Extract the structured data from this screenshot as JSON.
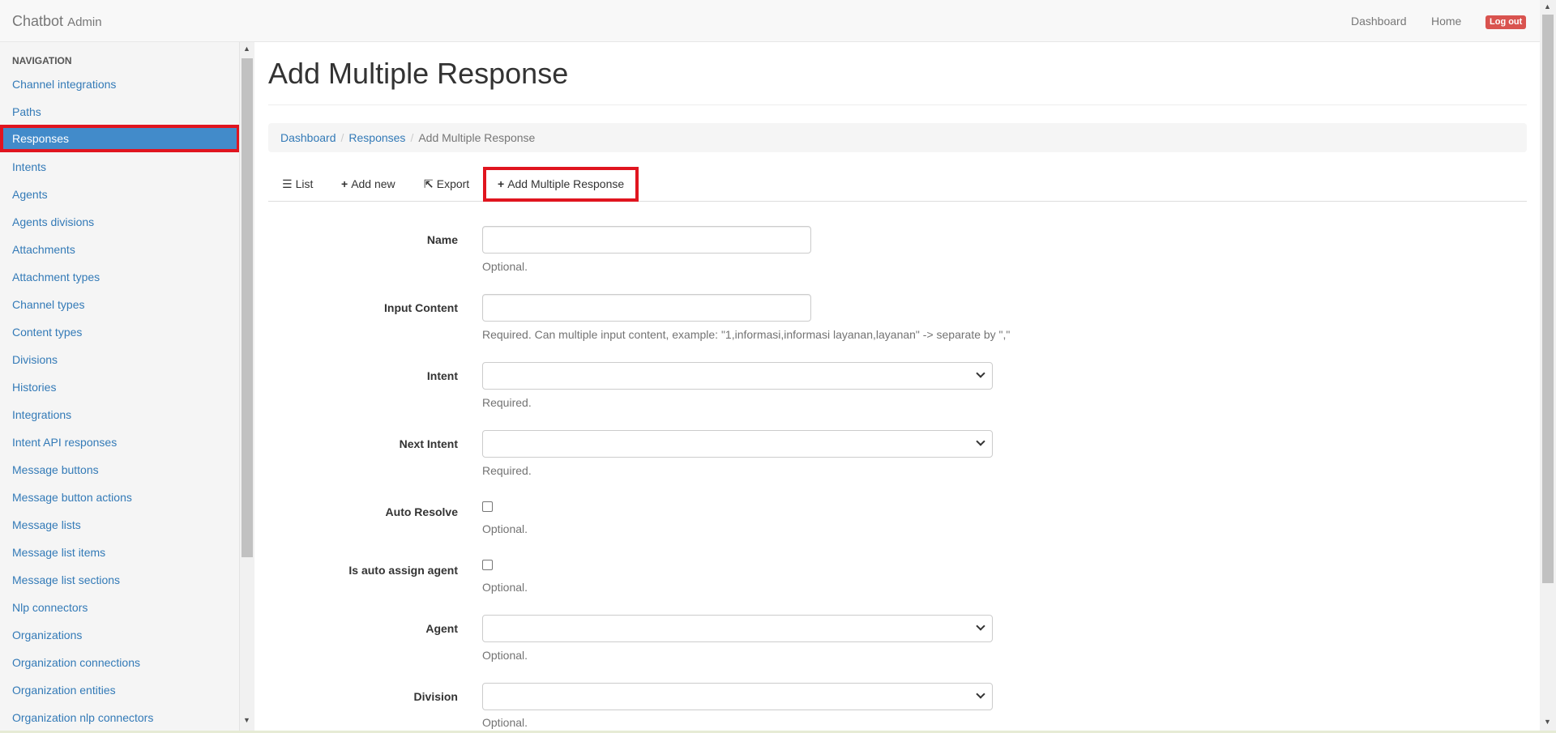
{
  "navbar": {
    "brand": "Chatbot",
    "brand_sub": "Admin",
    "links": [
      "Dashboard",
      "Home"
    ],
    "logout": "Log out"
  },
  "sidebar": {
    "header": "NAVIGATION",
    "items": [
      {
        "label": "Channel integrations"
      },
      {
        "label": "Paths"
      },
      {
        "label": "Responses",
        "active": true
      },
      {
        "label": "Intents"
      },
      {
        "label": "Agents"
      },
      {
        "label": "Agents divisions"
      },
      {
        "label": "Attachments"
      },
      {
        "label": "Attachment types"
      },
      {
        "label": "Channel types"
      },
      {
        "label": "Content types"
      },
      {
        "label": "Divisions"
      },
      {
        "label": "Histories"
      },
      {
        "label": "Integrations"
      },
      {
        "label": "Intent API responses"
      },
      {
        "label": "Message buttons"
      },
      {
        "label": "Message button actions"
      },
      {
        "label": "Message lists"
      },
      {
        "label": "Message list items"
      },
      {
        "label": "Message list sections"
      },
      {
        "label": "Nlp connectors"
      },
      {
        "label": "Organizations"
      },
      {
        "label": "Organization connections"
      },
      {
        "label": "Organization entities"
      },
      {
        "label": "Organization nlp connectors"
      }
    ]
  },
  "page": {
    "title": "Add Multiple Response"
  },
  "breadcrumb": [
    "Dashboard",
    "Responses",
    "Add Multiple Response"
  ],
  "tabs": [
    {
      "icon": "list-icon",
      "glyph": "☰",
      "label": "List"
    },
    {
      "icon": "plus-icon",
      "glyph": "+",
      "label": "Add new"
    },
    {
      "icon": "export-icon",
      "glyph": "⇱",
      "label": "Export"
    },
    {
      "icon": "plus-icon",
      "glyph": "+",
      "label": "Add Multiple Response",
      "active": true
    }
  ],
  "form": {
    "name": {
      "label": "Name",
      "value": "",
      "help": "Optional."
    },
    "input_content": {
      "label": "Input Content",
      "value": "",
      "help": "Required. Can multiple input content, example: \"1,informasi,informasi layanan,layanan\" -> separate by \",\""
    },
    "intent": {
      "label": "Intent",
      "value": "",
      "help": "Required."
    },
    "next_intent": {
      "label": "Next Intent",
      "value": "",
      "help": "Required."
    },
    "auto_resolve": {
      "label": "Auto Resolve",
      "checked": false,
      "help": "Optional."
    },
    "auto_assign_agent": {
      "label": "Is auto assign agent",
      "checked": false,
      "help": "Optional."
    },
    "agent": {
      "label": "Agent",
      "value": "",
      "help": "Optional."
    },
    "division": {
      "label": "Division",
      "value": "",
      "help": "Optional."
    }
  },
  "colors": {
    "link": "#337ab7",
    "active_nav": "#428bca",
    "highlight": "#e0151f",
    "logout": "#d9534f"
  }
}
